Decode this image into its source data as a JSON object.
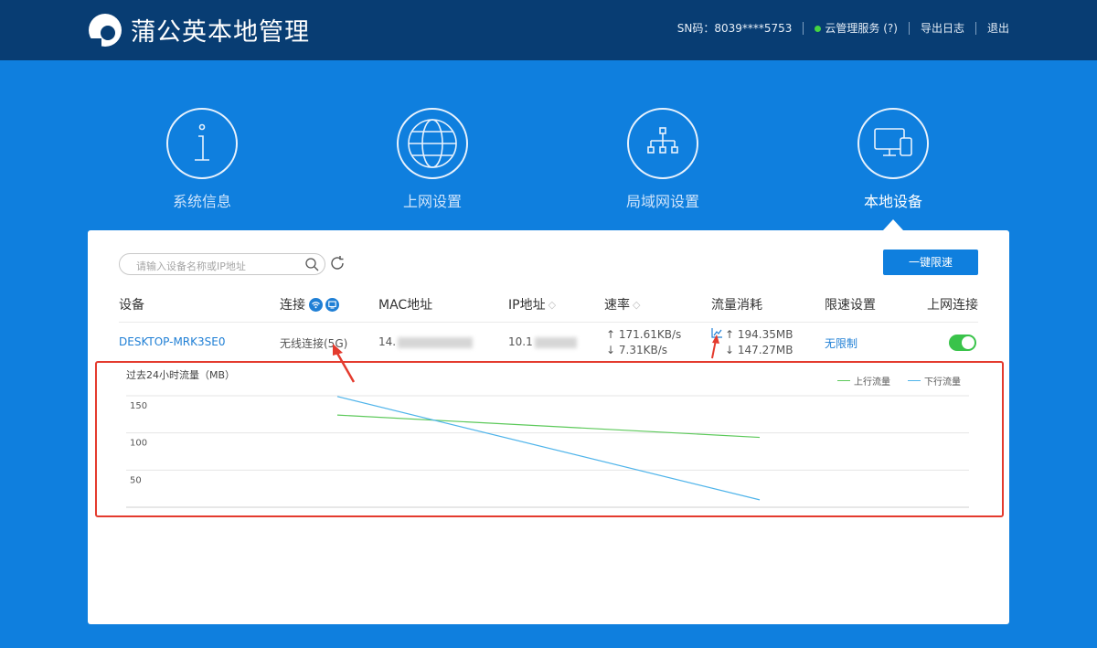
{
  "header": {
    "brand": "蒲公英本地管理",
    "sn": "SN码：8039****5753",
    "cloud": "云管理服务 (?)",
    "export": "导出日志",
    "logout": "退出"
  },
  "nav": [
    {
      "label": "系统信息",
      "icon": "info-icon"
    },
    {
      "label": "上网设置",
      "icon": "globe-icon"
    },
    {
      "label": "局域网设置",
      "icon": "network-tree-icon"
    },
    {
      "label": "本地设备",
      "icon": "devices-icon",
      "active": true
    }
  ],
  "toolbar": {
    "search_placeholder": "请输入设备名称或IP地址",
    "limit_button": "一键限速"
  },
  "table": {
    "headers": [
      "设备",
      "连接",
      "MAC地址",
      "IP地址",
      "速率",
      "流量消耗",
      "限速设置",
      "上网连接"
    ],
    "rows": [
      {
        "device": "DESKTOP-MRK3SE0",
        "connection": "无线连接(5G)",
        "mac": "14.",
        "ip": "10.1",
        "rate_up": "↑ 171.61KB/s",
        "rate_down": "↓ 7.31KB/s",
        "traffic_up": "↑ 194.35MB",
        "traffic_down": "↓ 147.27MB",
        "limit": "无限制",
        "online": true
      }
    ]
  },
  "colors": {
    "accent": "#0f7fde",
    "header": "#083d73",
    "upload_series": "#5cc95a",
    "download_series": "#4fb4ea",
    "annotation": "#e43b2e"
  },
  "chart_data": {
    "type": "line",
    "title": "过去24小时流量（MB）",
    "ylim": [
      0,
      150
    ],
    "yticks": [
      150,
      100,
      50
    ],
    "x": [
      0,
      1
    ],
    "series": [
      {
        "name": "上行流量",
        "values": [
          124,
          94
        ]
      },
      {
        "name": "下行流量",
        "values": [
          149,
          10
        ]
      }
    ],
    "grid": true,
    "legend": "top-right"
  }
}
